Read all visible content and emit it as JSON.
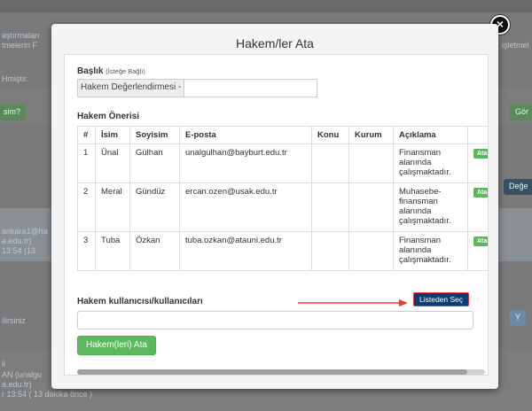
{
  "background": {
    "left_fragments": [
      "aştırmaları",
      "tmelerin F",
      "Hmiştir.",
      "sim?",
      "ankara1@ha",
      "a.edu.tr)",
      "13:54 (13",
      "ilirsiniz",
      "il",
      "AN (unalgu",
      "a.edu.tr)",
      "r 13:54 ( 13 dakika önce )"
    ],
    "right_fragments": [
      "işletmel",
      "Gör",
      "Değe",
      "Y"
    ]
  },
  "modal": {
    "title": "Hakem/ler Ata",
    "close_icon": "close-icon",
    "baslik_label": "Başlık",
    "baslik_optional": "(İsteğe Bağlı)",
    "title_prefix": "Hakem Değerlendirmesi -",
    "title_value": "",
    "oneri_label": "Hakem Önerisi",
    "table": {
      "headers": [
        "#",
        "İsim",
        "Soyisim",
        "E-posta",
        "Konu",
        "Kurum",
        "Açıklama",
        ""
      ],
      "rows": [
        {
          "no": "1",
          "isim": "Ünal",
          "soyisim": "Gülhan",
          "eposta": "unalgulhan@bayburt.edu.tr",
          "konu": "",
          "kurum": "",
          "aciklama": "Finansman alanında çalışmaktadır.",
          "action": "Ata"
        },
        {
          "no": "2",
          "isim": "Meral",
          "soyisim": "Gündüz",
          "eposta": "ercan.ozen@usak.edu.tr",
          "konu": "",
          "kurum": "",
          "aciklama": "Muhasebe-finansman alanında çalışmaktadır.",
          "action": "Ata"
        },
        {
          "no": "3",
          "isim": "Tuba",
          "soyisim": "Özkan",
          "eposta": "tuba.ozkan@atauni.edu.tr",
          "konu": "",
          "kurum": "",
          "aciklama": "Finansman alanında çalışmaktadır.",
          "action": "Ata"
        }
      ]
    },
    "kullanici_label": "Hakem kullanıcısı/kullanıcıları",
    "listeden_button": "Listeden Seç",
    "user_input_value": "",
    "submit_button": "Hakem(leri) Ata"
  },
  "colors": {
    "primary_green": "#5cb85c",
    "listeden_blue": "#0b3c76",
    "arrow_red": "#e53935"
  }
}
